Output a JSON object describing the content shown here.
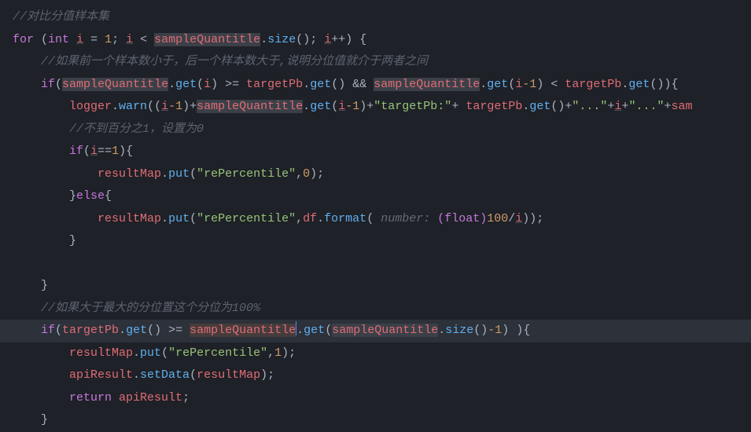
{
  "code": {
    "line1_comment": "//对比分值样本集",
    "line2": {
      "for": "for",
      "int": "int",
      "i": "i",
      "eq": " = ",
      "one": "1",
      "semi": "; ",
      "lt": " < ",
      "sampleQuantitle": "sampleQuantitle",
      "size": "size",
      "inc": "++",
      "brace": " {"
    },
    "line3_comment": "//如果前一个样本数小于，后一个样本数大于,说明分位值就介于两者之间",
    "line4": {
      "if": "if",
      "sampleQuantitle": "sampleQuantitle",
      "get": "get",
      "i": "i",
      "gte": " >= ",
      "targetPb": "targetPb",
      "and": " && ",
      "minus1": "-1",
      "lt": " < ",
      "brace": "{"
    },
    "line5": {
      "logger": "logger",
      "warn": "warn",
      "i": "i",
      "minus1": "-1",
      "sampleQuantitle": "sampleQuantitle",
      "get": "get",
      "str_targetPb": "\"targetPb:\"",
      "targetPb": "targetPb",
      "str_dots": "\"...\"",
      "plus": "+",
      "sam_trail": "sam"
    },
    "line6_comment": "//不到百分之1，设置为0",
    "line7": {
      "if": "if",
      "i": "i",
      "eqeq": "==",
      "one": "1",
      "brace": "{"
    },
    "line8": {
      "resultMap": "resultMap",
      "put": "put",
      "str_rePercentile": "\"rePercentile\"",
      "zero": "0"
    },
    "line9": {
      "close": "}",
      "else": "else",
      "brace": "{"
    },
    "line10": {
      "resultMap": "resultMap",
      "put": "put",
      "str_rePercentile": "\"rePercentile\"",
      "df": "df",
      "format": "format",
      "hint": " number: ",
      "cast": "(float)",
      "hundred": "100",
      "i": "i"
    },
    "line11_close": "}",
    "line13_close": "}",
    "line14_comment": "//如果大于最大的分位置这个分位为100%",
    "line15": {
      "if": "if",
      "targetPb": "targetPb",
      "get": "get",
      "gte": " >= ",
      "sampleQuantitle": "sampleQuantitle",
      "size": "size",
      "minus1": "-1",
      "brace": " ){"
    },
    "line16": {
      "resultMap": "resultMap",
      "put": "put",
      "str_rePercentile": "\"rePercentile\"",
      "one": "1"
    },
    "line17": {
      "apiResult": "apiResult",
      "setData": "setData",
      "resultMap": "resultMap"
    },
    "line18": {
      "return": "return",
      "apiResult": "apiResult"
    },
    "line19_close": "}"
  }
}
